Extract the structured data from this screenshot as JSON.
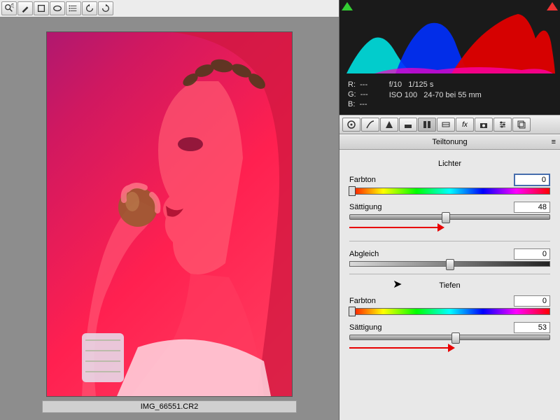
{
  "filename": "IMG_66551.CR2",
  "rgb": {
    "R": "---",
    "G": "---",
    "B": "---"
  },
  "exif": {
    "aperture": "f/10",
    "shutter": "1/125 s",
    "iso": "ISO 100",
    "lens": "24-70 bei 55 mm"
  },
  "panel_title": "Teiltonung",
  "sections": {
    "highlights_title": "Lichter",
    "shadows_title": "Tiefen",
    "balance_label": "Abgleich",
    "hue_label": "Farbton",
    "sat_label": "Sättigung"
  },
  "values": {
    "highlights_hue": "0",
    "highlights_sat": "48",
    "balance": "0",
    "shadows_hue": "0",
    "shadows_sat": "53"
  }
}
